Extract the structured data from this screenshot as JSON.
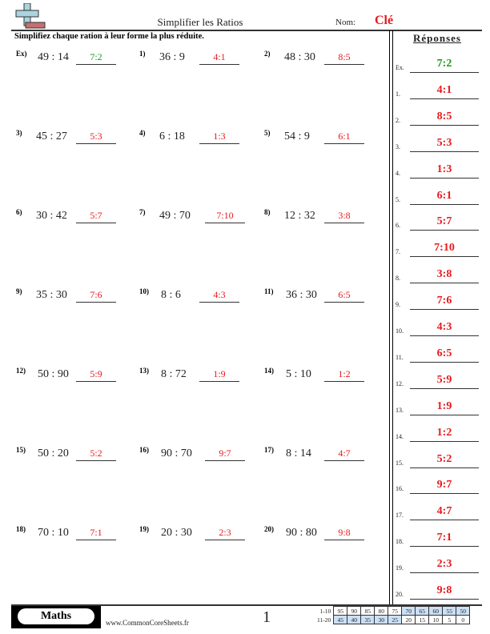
{
  "header": {
    "title": "Simplifier les Ratios",
    "nom_label": "Nom:",
    "nom_value": "Clé",
    "instructions": "Simplifiez chaque ration à leur forme la plus réduite."
  },
  "colors": {
    "answer": "#e8191c",
    "example": "#1a9a1a",
    "score_highlight": "#cce0f5"
  },
  "problems": [
    {
      "label": "Ex)",
      "expr": "49 : 14",
      "answer": "7:2",
      "example": true
    },
    {
      "label": "1)",
      "expr": "36 : 9",
      "answer": "4:1"
    },
    {
      "label": "2)",
      "expr": "48 : 30",
      "answer": "8:5"
    },
    {
      "label": "3)",
      "expr": "45 : 27",
      "answer": "5:3"
    },
    {
      "label": "4)",
      "expr": "6 : 18",
      "answer": "1:3"
    },
    {
      "label": "5)",
      "expr": "54 : 9",
      "answer": "6:1"
    },
    {
      "label": "6)",
      "expr": "30 : 42",
      "answer": "5:7"
    },
    {
      "label": "7)",
      "expr": "49 : 70",
      "answer": "7:10"
    },
    {
      "label": "8)",
      "expr": "12 : 32",
      "answer": "3:8"
    },
    {
      "label": "9)",
      "expr": "35 : 30",
      "answer": "7:6"
    },
    {
      "label": "10)",
      "expr": "8 : 6",
      "answer": "4:3"
    },
    {
      "label": "11)",
      "expr": "36 : 30",
      "answer": "6:5"
    },
    {
      "label": "12)",
      "expr": "50 : 90",
      "answer": "5:9"
    },
    {
      "label": "13)",
      "expr": "8 : 72",
      "answer": "1:9"
    },
    {
      "label": "14)",
      "expr": "5 : 10",
      "answer": "1:2"
    },
    {
      "label": "15)",
      "expr": "50 : 20",
      "answer": "5:2"
    },
    {
      "label": "16)",
      "expr": "90 : 70",
      "answer": "9:7"
    },
    {
      "label": "17)",
      "expr": "8 : 14",
      "answer": "4:7"
    },
    {
      "label": "18)",
      "expr": "70 : 10",
      "answer": "7:1"
    },
    {
      "label": "19)",
      "expr": "20 : 30",
      "answer": "2:3"
    },
    {
      "label": "20)",
      "expr": "90 : 80",
      "answer": "9:8"
    }
  ],
  "answer_key": {
    "title": "Réponses",
    "items": [
      {
        "label": "Ex.",
        "value": "7:2",
        "example": true
      },
      {
        "label": "1.",
        "value": "4:1"
      },
      {
        "label": "2.",
        "value": "8:5"
      },
      {
        "label": "3.",
        "value": "5:3"
      },
      {
        "label": "4.",
        "value": "1:3"
      },
      {
        "label": "5.",
        "value": "6:1"
      },
      {
        "label": "6.",
        "value": "5:7"
      },
      {
        "label": "7.",
        "value": "7:10"
      },
      {
        "label": "8.",
        "value": "3:8"
      },
      {
        "label": "9.",
        "value": "7:6"
      },
      {
        "label": "10.",
        "value": "4:3"
      },
      {
        "label": "11.",
        "value": "6:5"
      },
      {
        "label": "12.",
        "value": "5:9"
      },
      {
        "label": "13.",
        "value": "1:9"
      },
      {
        "label": "14.",
        "value": "1:2"
      },
      {
        "label": "15.",
        "value": "5:2"
      },
      {
        "label": "16.",
        "value": "9:7"
      },
      {
        "label": "17.",
        "value": "4:7"
      },
      {
        "label": "18.",
        "value": "7:1"
      },
      {
        "label": "19.",
        "value": "2:3"
      },
      {
        "label": "20.",
        "value": "9:8"
      }
    ]
  },
  "footer": {
    "subject": "Maths",
    "site": "www.CommonCoreSheets.fr",
    "page": "1",
    "score_rows": [
      {
        "label": "1-10",
        "cells": [
          "95",
          "90",
          "85",
          "80",
          "75",
          "70",
          "65",
          "60",
          "55",
          "50"
        ],
        "highlight": [
          5,
          6,
          7,
          8,
          9
        ]
      },
      {
        "label": "11-20",
        "cells": [
          "45",
          "40",
          "35",
          "30",
          "25",
          "20",
          "15",
          "10",
          "5",
          "0"
        ],
        "highlight": [
          0,
          1,
          2,
          3,
          4
        ]
      }
    ]
  }
}
